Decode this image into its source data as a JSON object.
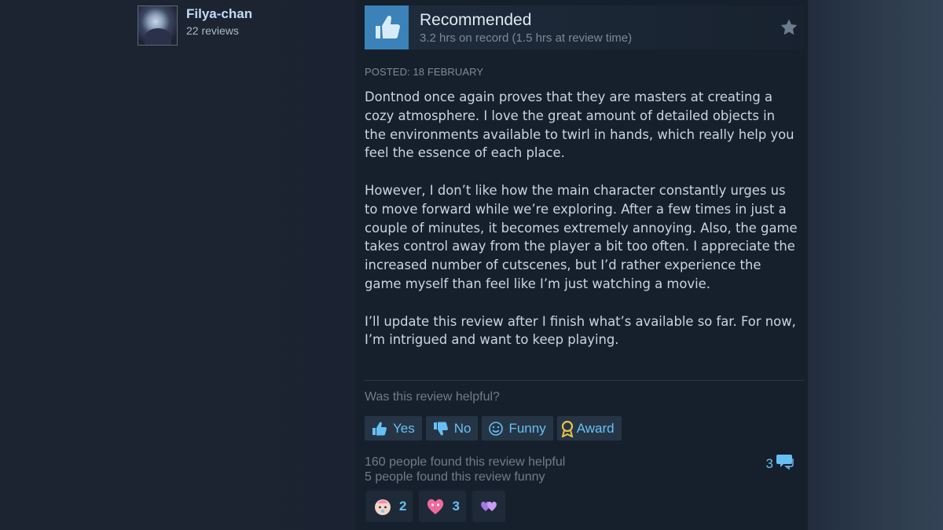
{
  "author": {
    "name": "Filya-chan",
    "reviews": "22 reviews"
  },
  "review": {
    "verdict": "Recommended",
    "hours": "3.2 hrs on record (1.5 hrs at review time)",
    "posted": "POSTED: 18 FEBRUARY",
    "paragraphs": [
      "Dontnod once again proves that they are masters at creating a cozy atmosphere. I love the great amount of detailed objects in the environments available to twirl in hands, which really help you feel the essence of each place.",
      "However, I don’t like how the main character constantly urges us to move forward while we’re exploring. After a few times in just a couple of minutes, it becomes extremely annoying. Also, the game takes control away from the player a bit too often. I appreciate the increased number of cutscenes, but I’d rather experience the game myself than feel like I’m just watching a movie.",
      "I’ll update this review after I finish what’s available so far. For now, I’m intrigued and want to keep playing."
    ]
  },
  "feedback": {
    "question": "Was this review helpful?",
    "buttons": {
      "yes": "Yes",
      "no": "No",
      "funny": "Funny",
      "award": "Award"
    },
    "helpful_count": "160 people found this review helpful",
    "funny_count": "5 people found this review funny",
    "comments_count": "3"
  },
  "awards": [
    {
      "icon": "baby-face-icon",
      "count": "2"
    },
    {
      "icon": "heart-eyes-icon",
      "count": "3"
    },
    {
      "icon": "purple-hearts-icon",
      "count": ""
    }
  ],
  "colors": {
    "accent": "#66c0f4",
    "thumb_bg": "#3a82b8",
    "panel_bg": "#16202d",
    "page_bg": "#1b2433"
  }
}
